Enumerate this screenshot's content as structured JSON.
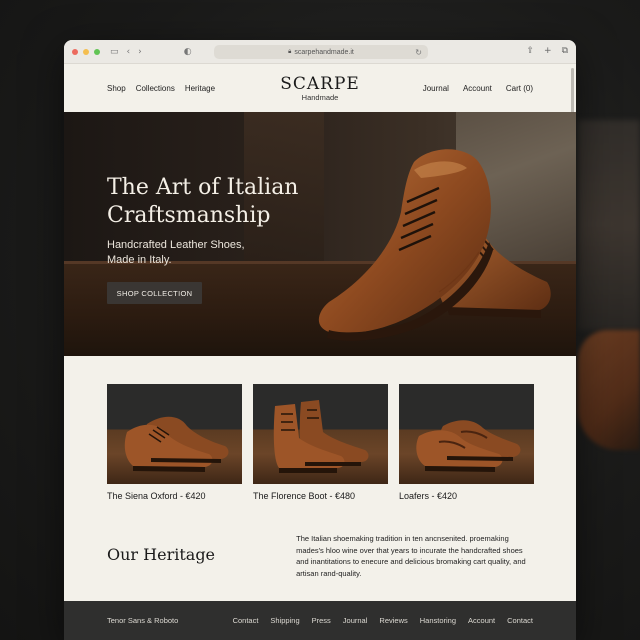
{
  "browser": {
    "url": "scarpehandmade.it",
    "traffic_lights": [
      "#ec6a5e",
      "#f4be4f",
      "#61c454"
    ]
  },
  "nav": {
    "left": [
      "Shop",
      "Collections",
      "Heritage"
    ],
    "brand": "SCARPE",
    "brand_sub": "Handmade",
    "right": [
      "Journal",
      "Account",
      "Cart (0)"
    ]
  },
  "hero": {
    "title_line1": "The Art of Italian",
    "title_line2": "Craftsmanship",
    "subtitle_line1": "Handcrafted Leather Shoes,",
    "subtitle_line2": "Made in Italy.",
    "cta": "SHOP COLLECTION"
  },
  "products": [
    {
      "caption": "The Siena Oxford - €420",
      "style": "oxford"
    },
    {
      "caption": "The Florence Boot - €480",
      "style": "boot"
    },
    {
      "caption": "Loafers - €420",
      "style": "loafer"
    }
  ],
  "heritage": {
    "title": "Our Heritage",
    "text": "The Italian shoemaking tradition in ten ancnsenited. proemaking mades's hloo wine over that years to incurate the handcrafted shoes and inantitations to enecure and delicious bromaking cart quality, and artisan rand-quality."
  },
  "footer": {
    "left": "Tenor Sans & Roboto",
    "links": [
      "Contact",
      "Shipping",
      "Press",
      "Journal",
      "Reviews",
      "Hanstoring",
      "Account",
      "Contact"
    ]
  },
  "colors": {
    "page_bg": "#f3f1ea",
    "leather": "#8a4a22",
    "footer_bg": "#2f2f2e",
    "button_bg": "#3a3633"
  }
}
